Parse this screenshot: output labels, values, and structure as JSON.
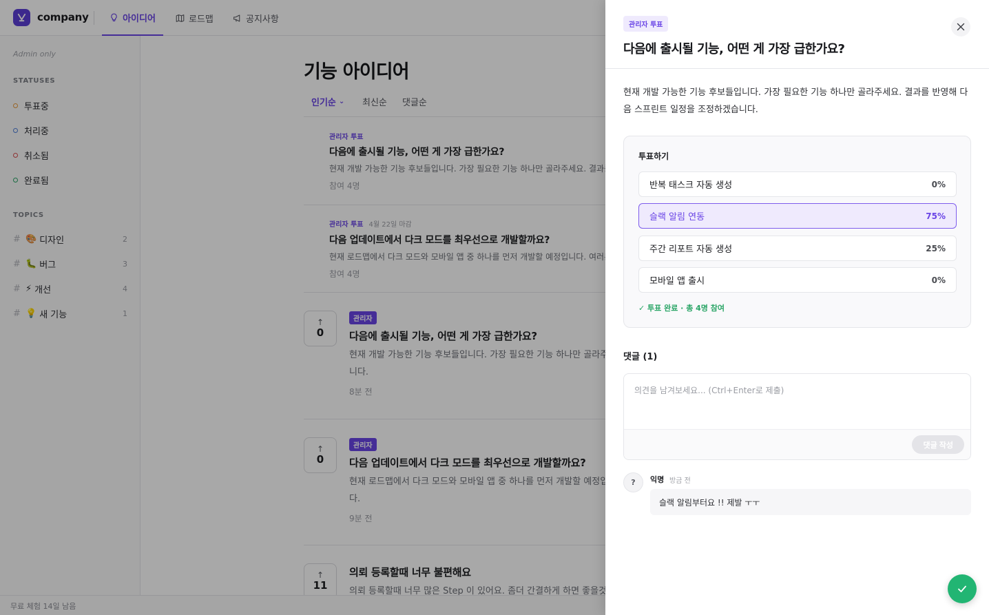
{
  "header": {
    "brand": "company",
    "tabs": [
      {
        "label": "아이디어",
        "icon": "lightbulb-icon",
        "active": true
      },
      {
        "label": "로드맵",
        "icon": "map-icon"
      },
      {
        "label": "공지사항",
        "icon": "megaphone-icon"
      }
    ]
  },
  "sidebar": {
    "admin_only": "Admin only",
    "statuses_heading": "STATUSES",
    "statuses": [
      {
        "label": "투표중",
        "color": "#e89a3c"
      },
      {
        "label": "처리중",
        "color": "#4e7fd9"
      },
      {
        "label": "취소됨",
        "color": "#d94e4e"
      },
      {
        "label": "완료됨",
        "color": "#2aa566"
      }
    ],
    "topics_heading": "TOPICS",
    "topics": [
      {
        "emoji": "🎨",
        "label": "디자인",
        "count": "2"
      },
      {
        "emoji": "🐛",
        "label": "버그",
        "count": "3"
      },
      {
        "emoji": "⚡",
        "label": "개선",
        "count": "4"
      },
      {
        "emoji": "💡",
        "label": "새 기능",
        "count": "1"
      }
    ]
  },
  "main": {
    "title": "기능 아이디어",
    "sort_tabs": [
      "인기순",
      "최신순",
      "댓글순"
    ],
    "poll_cards": [
      {
        "tag": "관리자 투표",
        "deadline": "",
        "title": "다음에 출시될 기능, 어떤 게 가장 급한가요?",
        "desc": "현재 개발 가능한 기능 후보들입니다. 가장 필요한 기능 하나만 골라주세요. 결과를 반",
        "meta": "참여 4명"
      },
      {
        "tag": "관리자 투표",
        "deadline": "4월 22일 마감",
        "title": "다음 업데이트에서 다크 모드를 최우선으로 개발할까요?",
        "desc": "현재 로드맵에서 다크 모드와 모바일 앱 중 하나를 먼저 개발할 예정입니다. 여러분의",
        "meta": "참여 4명"
      }
    ],
    "posts": [
      {
        "votes": "0",
        "badge": "관리자",
        "title": "다음에 출시될 기능, 어떤 게 가장 급한가요?",
        "desc": "현재 개발 가능한 기능 후보들입니다. 가장 필요한 기능 하나만 골라주세요. 결과를",
        "desc2": "니다.",
        "meta": "8분 전"
      },
      {
        "votes": "0",
        "badge": "관리자",
        "title": "다음 업데이트에서 다크 모드를 최우선으로 개발할까요?",
        "desc": "현재 로드맵에서 다크 모드와 모바일 앱 중 하나를 먼저 개발할 예정입니다. 여러분",
        "desc2": "다.",
        "meta": "9분 전"
      },
      {
        "votes": "11",
        "badge": "",
        "title": "의뢰 등록할때 너무 불편해요",
        "desc": "의뢰 등록할때 너무 많은 Step 이 있어요. 좀더 간결하게 하면 좋을것 같",
        "desc2": "",
        "meta": ""
      }
    ]
  },
  "trial": "무료 체험 14일 남음",
  "drawer": {
    "tag": "관리자 투표",
    "title": "다음에 출시될 기능, 어떤 게 가장 급한가요?",
    "description": "현재 개발 가능한 기능 후보들입니다. 가장 필요한 기능 하나만 골라주세요. 결과를 반영해 다음 스프린트 일정을 조정하겠습니다.",
    "poll": {
      "heading": "투표하기",
      "options": [
        {
          "label": "반복 태스크 자동 생성",
          "percent": "0%"
        },
        {
          "label": "슬랙 알림 연동",
          "percent": "75%",
          "selected": true
        },
        {
          "label": "주간 리포트 자동 생성",
          "percent": "25%"
        },
        {
          "label": "모바일 앱 출시",
          "percent": "0%"
        }
      ],
      "status": "✓ 투표 완료 · 총 4명 참여"
    },
    "comments": {
      "heading": "댓글 (1)",
      "placeholder": "의견을 남겨보세요... (Ctrl+Enter로 제출)",
      "submit_label": "댓글 작성",
      "items": [
        {
          "avatar": "?",
          "author": "익명",
          "time": "방금 전",
          "text": "슬랙 알림부터요 !! 제발 ㅜㅜ"
        }
      ]
    }
  },
  "colors": {
    "accent": "#6a45e6",
    "success": "#22b573"
  }
}
